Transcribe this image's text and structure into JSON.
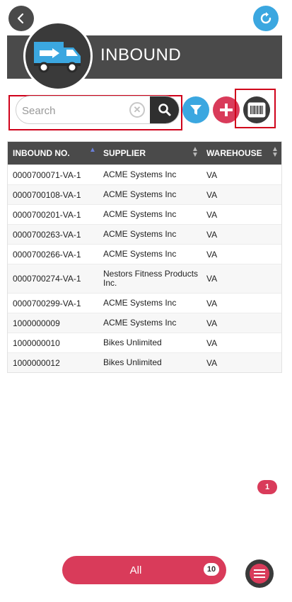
{
  "header": {
    "title": "INBOUND",
    "accent_color": "#d93b5a",
    "header_color": "#4a4a4a",
    "refresh_color": "#3ba7e0"
  },
  "icons": {
    "back": "chevron-left-icon",
    "refresh": "refresh-icon",
    "logo": "truck-inbound-icon",
    "clear": "clear-icon",
    "search": "search-icon",
    "filter": "filter-icon",
    "add": "plus-icon",
    "barcode": "barcode-icon",
    "menu": "menu-icon"
  },
  "search": {
    "placeholder": "Search",
    "value": ""
  },
  "table": {
    "columns": [
      {
        "label": "INBOUND NO.",
        "sort": "ascending"
      },
      {
        "label": "SUPPLIER",
        "sort": "none"
      },
      {
        "label": "WAREHOUSE",
        "sort": "none"
      }
    ],
    "rows": [
      {
        "inbound_no": "0000700071-VA-1",
        "supplier": "ACME Systems Inc",
        "warehouse": "VA"
      },
      {
        "inbound_no": "0000700108-VA-1",
        "supplier": "ACME Systems Inc",
        "warehouse": "VA"
      },
      {
        "inbound_no": "0000700201-VA-1",
        "supplier": "ACME Systems Inc",
        "warehouse": "VA"
      },
      {
        "inbound_no": "0000700263-VA-1",
        "supplier": "ACME Systems Inc",
        "warehouse": "VA"
      },
      {
        "inbound_no": "0000700266-VA-1",
        "supplier": "ACME Systems Inc",
        "warehouse": "VA"
      },
      {
        "inbound_no": "0000700274-VA-1",
        "supplier": "Nestors Fitness Products Inc.",
        "warehouse": "VA"
      },
      {
        "inbound_no": "0000700299-VA-1",
        "supplier": "ACME Systems Inc",
        "warehouse": "VA"
      },
      {
        "inbound_no": "1000000009",
        "supplier": "ACME Systems Inc",
        "warehouse": "VA"
      },
      {
        "inbound_no": "1000000010",
        "supplier": "Bikes Unlimited",
        "warehouse": "VA"
      },
      {
        "inbound_no": "1000000012",
        "supplier": "Bikes Unlimited",
        "warehouse": "VA"
      }
    ]
  },
  "pagination": {
    "page": "1"
  },
  "footer": {
    "filter_label": "All",
    "count": "10"
  }
}
